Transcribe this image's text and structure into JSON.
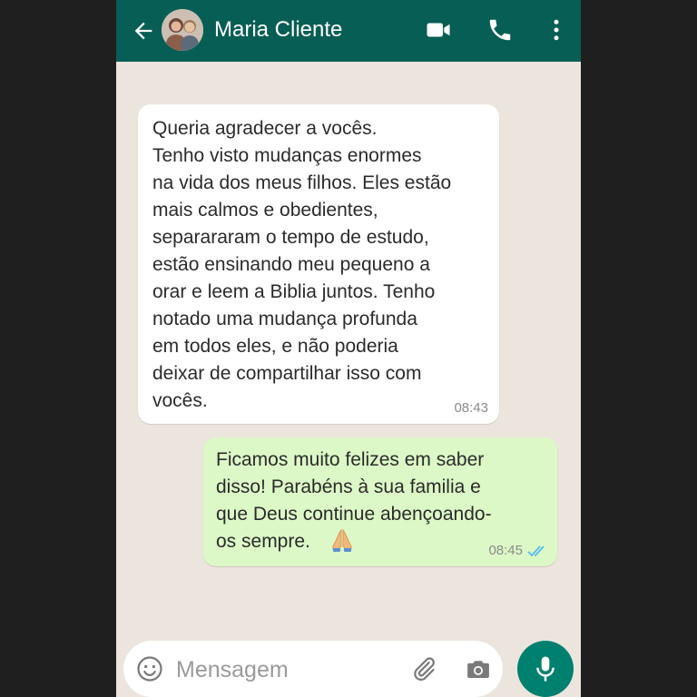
{
  "header": {
    "contact_name": "Maria Cliente",
    "icons": [
      "back-arrow-icon",
      "avatar",
      "video-call-icon",
      "phone-call-icon",
      "more-options-icon"
    ],
    "color": "#075e54"
  },
  "messages": [
    {
      "direction": "incoming",
      "text": "Queria agradecer a vocês.\nTenho visto mudanças enormes\nna vida dos meus filhos. Eles estão\nmais calmos e obedientes,\nseparararam o tempo de estudo,\nestão ensinando meu pequeno a\norar e leem a Biblia juntos. Tenho\nnotado uma mudança profunda\nem todos eles, e não poderia\ndeixar de compartilhar isso com\nvocês.",
      "time": "08:43",
      "bubble_color": "#ffffff"
    },
    {
      "direction": "outgoing",
      "text": "Ficamos muito felizes em saber\ndisso! Parabéns à sua familia e\nque Deus continue abençoando-\nos sempre.",
      "emoji": "praying-hands",
      "time": "08:45",
      "status": "read",
      "bubble_color": "#dcf8c6"
    }
  ],
  "input": {
    "placeholder": "Mensagem",
    "value": ""
  },
  "colors": {
    "background": "#ece5dd",
    "accent": "#00806f",
    "read_ticks": "#53bdeb"
  }
}
